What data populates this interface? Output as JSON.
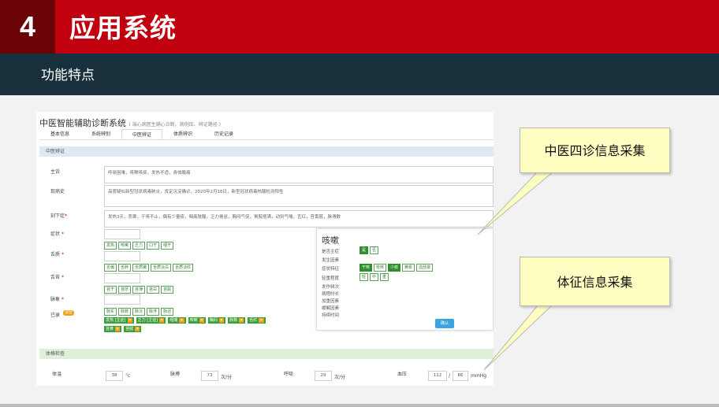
{
  "slide": {
    "number": "4",
    "title": "应用系统",
    "subtitle": "功能特点"
  },
  "app": {
    "title": "中医智能辅助诊断系统",
    "title_note": "( 端心病医生辅心诊断、病例库、辨证路径 )",
    "tabs": [
      "基本信息",
      "系统辨别",
      "中医辨证",
      "体质辨识",
      "历史记录"
    ],
    "active_tab": "中医辨证",
    "section_tcm": "中医辨证",
    "fields": {
      "chief_complaint": {
        "label": "主诉",
        "value": "呼吸困难，咳嗽咳痰，发热不适，身体酸痛"
      },
      "present_history": {
        "label": "现病史",
        "value": "高度疑似新型冠状病毒肺炎，肯定沉淀确诊，2020年2月16日，新型冠状病毒核酸检测阳性"
      },
      "current_symptoms": {
        "label": "刻下症",
        "value": "发热3天，恶寒，干咳不止，偶有少量痰，咽痛肢酸，乏力倦怠，胸闷气促，胃脘痞满，动则气喘，舌红，苔黄腻，脉滑数"
      },
      "symptom": {
        "label": "症状"
      },
      "tongue_color": {
        "label": "舌质"
      },
      "tongue_coating": {
        "label": "舌苔"
      },
      "pulse": {
        "label": "脉象"
      },
      "selected": {
        "label": "已录"
      }
    },
    "symptom_chips": [
      "发热",
      "咳嗽",
      "乏力",
      "口干",
      "咽干"
    ],
    "tongue_color_chips": [
      "舌偏",
      "舌胖",
      "舌质嫩",
      "舌质淡白",
      "舌质淡红"
    ],
    "tongue_coating_chips": [
      "苔干",
      "苔厚",
      "苔薄",
      "苔白",
      "苔腻"
    ],
    "pulse_chips": [
      "脉实",
      "脉数",
      "脉沉",
      "脉浮",
      "脉迟"
    ],
    "clear_button": "清空",
    "selected_tags_row1": [
      "发热 [主症]",
      "乏力 [主症]",
      "咽痛",
      "咳嗽",
      "胸闷",
      "脉数",
      "舌红"
    ],
    "selected_tags_row2": [
      "苔黄",
      "苔腻"
    ],
    "cough_panel": {
      "title": "咳嗽",
      "rows": [
        {
          "label": "是否主症",
          "options": [
            "是",
            "否"
          ],
          "selected": [
            "是"
          ]
        },
        {
          "label": "发生因素",
          "options": [],
          "selected": []
        },
        {
          "label": "症状特征",
          "options": [
            "干咳",
            "呛咳",
            "少痰",
            "黄痰",
            "血丝痰"
          ],
          "selected": [
            "干咳",
            "少痰"
          ]
        },
        {
          "label": "轻重程度",
          "options": [
            "轻",
            "中",
            "重"
          ],
          "selected": []
        },
        {
          "label": "发作频次",
          "options": [],
          "selected": []
        },
        {
          "label": "病程时长",
          "options": [],
          "selected": []
        },
        {
          "label": "加重因素",
          "options": [],
          "selected": []
        },
        {
          "label": "缓解因素",
          "options": [],
          "selected": []
        },
        {
          "label": "持续时间",
          "options": [],
          "selected": []
        }
      ],
      "confirm": "确认"
    },
    "section_vitals": "体格检查",
    "vitals": {
      "temperature": {
        "label": "体温",
        "value": "38",
        "unit": "°c"
      },
      "pulse_rate": {
        "label": "脉搏",
        "value": "73",
        "unit": "次/分"
      },
      "respiration": {
        "label": "呼吸",
        "value": "29",
        "unit": "次/分"
      },
      "blood_pressure": {
        "label": "血压",
        "systolic": "112",
        "sep": "/",
        "diastolic": "86",
        "unit": "mmHg"
      }
    }
  },
  "callouts": {
    "four_diagnosis": "中医四诊信息采集",
    "vital_signs": "体征信息采集"
  },
  "colors": {
    "header_red": "#c0000e",
    "number_dark_red": "#6a0306",
    "subheader_navy": "#17303c",
    "callout_yellow": "#ffffc2",
    "chip_green": "#2f8f2f"
  }
}
